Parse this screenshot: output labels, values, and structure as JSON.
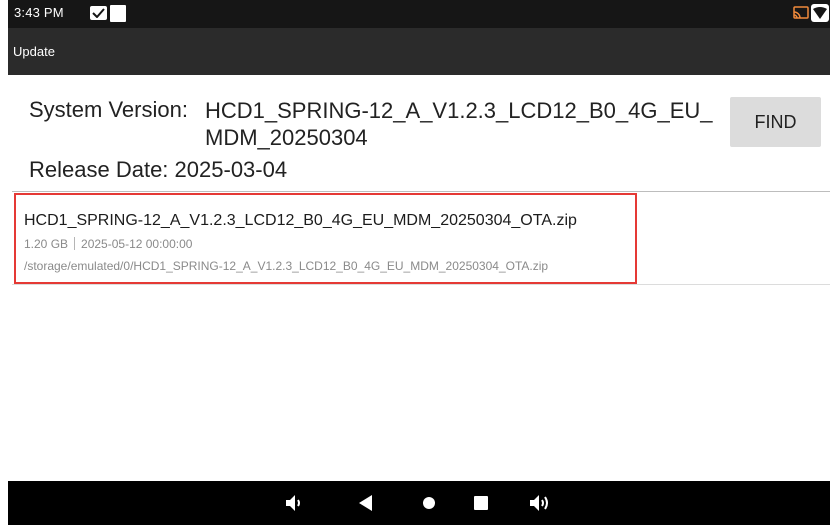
{
  "status_bar": {
    "time": "3:43 PM",
    "icons": [
      "checkmark-notification-icon",
      "blank-notification-icon",
      "cast-icon",
      "wifi-icon"
    ]
  },
  "app_bar": {
    "title": "Update"
  },
  "system": {
    "version_label": "System Version:",
    "version_value": "HCD1_SPRING-12_A_V1.2.3_LCD12_B0_4G_EU_MDM_20250304",
    "release_label": "Release Date:",
    "release_value": "2025-03-04",
    "find_label": "FIND"
  },
  "files": [
    {
      "name": "HCD1_SPRING-12_A_V1.2.3_LCD12_B0_4G_EU_MDM_20250304_OTA.zip",
      "size": "1.20 GB",
      "date": "2025-05-12 00:00:00",
      "path": "/storage/emulated/0/HCD1_SPRING-12_A_V1.2.3_LCD12_B0_4G_EU_MDM_20250304_OTA.zip",
      "highlighted": true
    }
  ],
  "nav_bar": {
    "buttons": [
      "volume-down-icon",
      "back-icon",
      "home-icon",
      "recents-icon",
      "volume-up-icon"
    ]
  },
  "colors": {
    "status_bar": "#161616",
    "app_bar": "#2b2b2b",
    "highlight_border": "#e53935",
    "find_button": "#dcdcdc"
  }
}
